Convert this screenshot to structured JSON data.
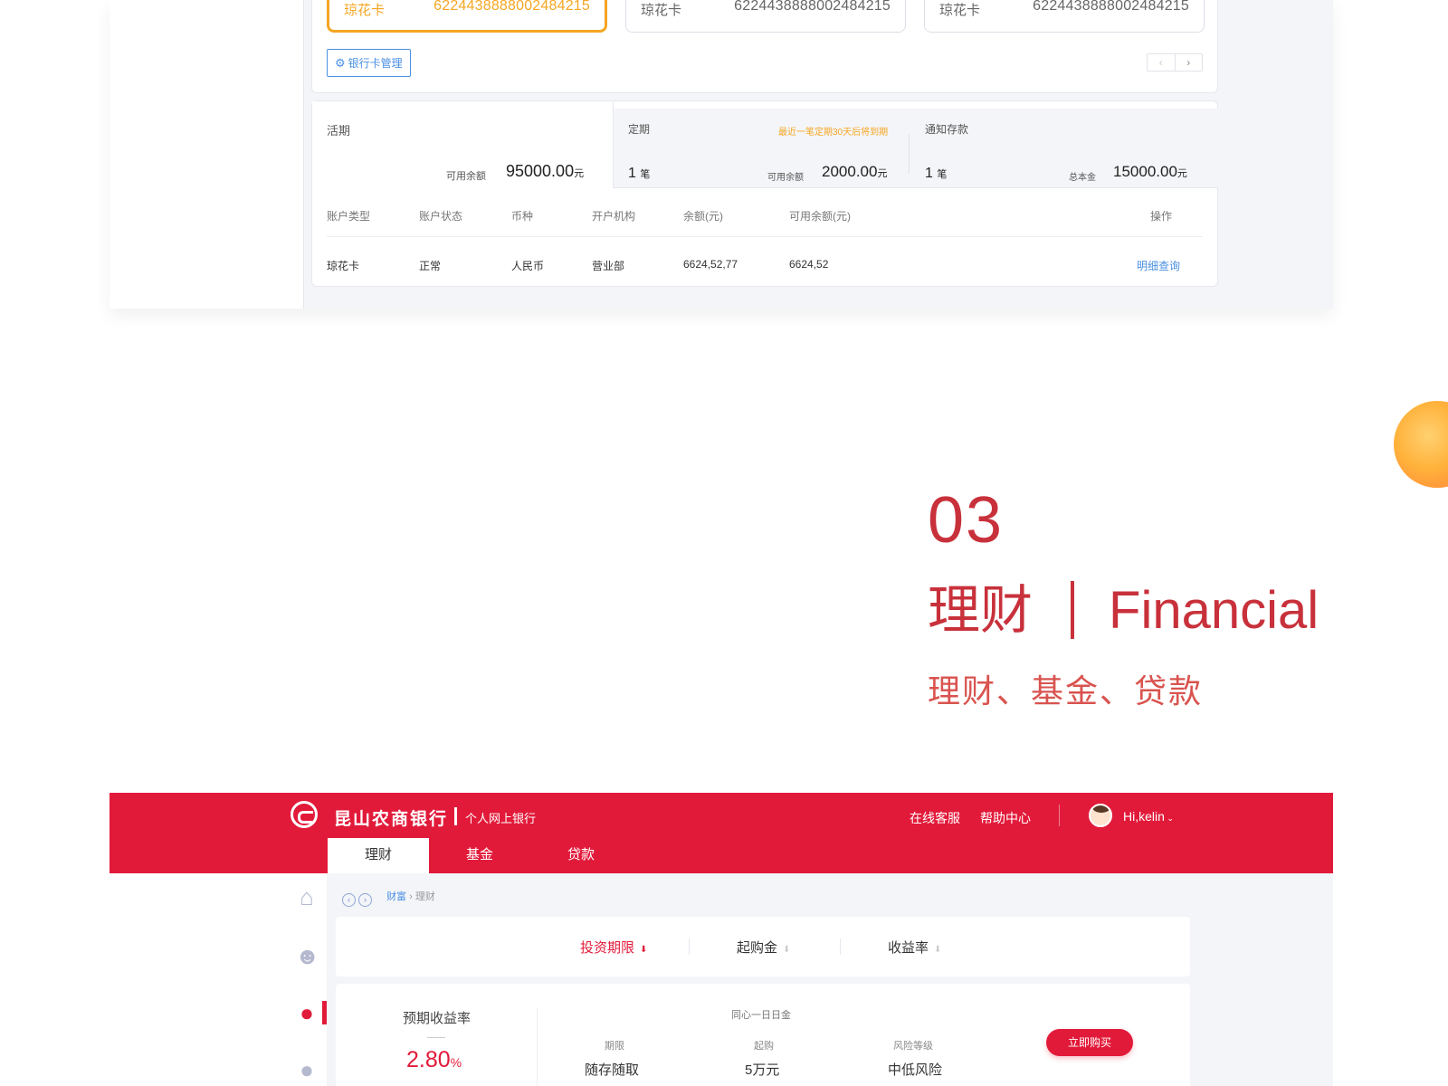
{
  "top_panel": {
    "cards": [
      {
        "name": "琼花卡",
        "number": "6224438888002484215"
      },
      {
        "name": "琼花卡",
        "number": "6224438888002484215"
      },
      {
        "name": "琼花卡",
        "number": "6224438888002484215"
      }
    ],
    "card_manage_label": "银行卡管理",
    "pager_prev": "‹",
    "pager_next": "›",
    "huoqi": {
      "label": "活期",
      "available_label": "可用余额",
      "available_value": "95000.00",
      "unit": "元"
    },
    "dingqi": {
      "label": "定期",
      "notice": "最近一笔定期30天后将到期",
      "count": "1",
      "count_unit": "笔",
      "available_label": "可用余额",
      "available_value": "2000.00",
      "unit": "元"
    },
    "tongzhi": {
      "label": "通知存款",
      "count": "1",
      "count_unit": "笔",
      "principal_label": "总本金",
      "principal_value": "15000.00",
      "unit": "元"
    },
    "table": {
      "headers": [
        "账户类型",
        "账户状态",
        "币种",
        "开户机构",
        "余额(元)",
        "可用余额(元)",
        "操作"
      ],
      "rows": [
        {
          "type": "琼花卡",
          "status": "正常",
          "currency": "人民币",
          "branch": "营业部",
          "balance": "6624,52,77",
          "available": "6624,52",
          "action": "明细查询"
        }
      ]
    }
  },
  "section": {
    "number": "03",
    "title_cn": "理财",
    "title_en": "Financial",
    "subtitle": "理财、基金、贷款"
  },
  "bottom_panel": {
    "brand": "昆山农商银行",
    "brand_sub": "个人网上银行",
    "top_links": [
      "在线客服",
      "帮助中心"
    ],
    "user": "Hi,kelin",
    "tabs": [
      "理财",
      "基金",
      "贷款"
    ],
    "breadcrumb": {
      "parent": "财富",
      "sep": "›",
      "current": "理财"
    },
    "filters": [
      {
        "label": "投资期限",
        "arrow": "⬇"
      },
      {
        "label": "起购金",
        "arrow": "⬇"
      },
      {
        "label": "收益率",
        "arrow": "⬇"
      }
    ],
    "product": {
      "rate_label": "预期收益率",
      "rate_value": "2.80",
      "rate_unit": "%",
      "name": "同心一日日金",
      "fields": [
        {
          "key": "期限",
          "value": "随存随取"
        },
        {
          "key": "起购",
          "value": "5万元"
        },
        {
          "key": "风险等级",
          "value": "中低风险"
        }
      ],
      "buy_label": "立即购买"
    }
  },
  "colors": {
    "brand_red": "#e21a3a",
    "heading_red": "#c8313b",
    "accent_orange": "#f5a623",
    "link_blue": "#4a90e2"
  },
  "icons": [
    "gear-icon",
    "home-icon",
    "smile-icon",
    "piggy-bank-icon",
    "user-icon",
    "bank-logo-icon",
    "avatar-icon"
  ]
}
